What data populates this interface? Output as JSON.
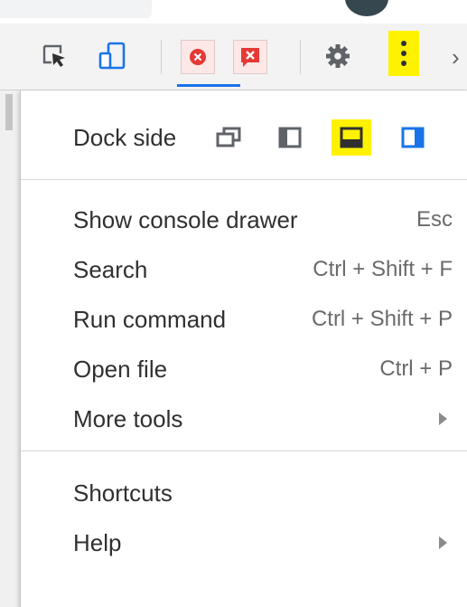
{
  "toolbar": {
    "icons": [
      {
        "name": "select-element-icon"
      },
      {
        "name": "device-toolbar-icon"
      },
      {
        "name": "errors-icon",
        "color": "#e53935"
      },
      {
        "name": "issues-icon",
        "color": "#e53935"
      },
      {
        "name": "settings-gear-icon"
      },
      {
        "name": "more-options-kebab-icon",
        "highlight": "#fff200"
      },
      {
        "name": "chevron-right-icon"
      }
    ],
    "active_tab_color": "#1a73e8",
    "overflow_glyph": "›"
  },
  "menu": {
    "dock_side": {
      "label": "Dock side",
      "options": [
        {
          "name": "undock-into-separate-window-icon"
        },
        {
          "name": "dock-to-left-icon"
        },
        {
          "name": "dock-to-bottom-icon",
          "selected": true,
          "highlight": "#fff200"
        },
        {
          "name": "dock-to-right-icon",
          "color": "#1a73e8"
        }
      ]
    },
    "items": [
      {
        "label": "Show console drawer",
        "shortcut": "Esc"
      },
      {
        "label": "Search",
        "shortcut": "Ctrl + Shift + F"
      },
      {
        "label": "Run command",
        "shortcut": "Ctrl + Shift + P"
      },
      {
        "label": "Open file",
        "shortcut": "Ctrl + P"
      },
      {
        "label": "More tools",
        "submenu": true
      }
    ],
    "footer_items": [
      {
        "label": "Shortcuts"
      },
      {
        "label": "Help",
        "submenu": true
      }
    ]
  }
}
